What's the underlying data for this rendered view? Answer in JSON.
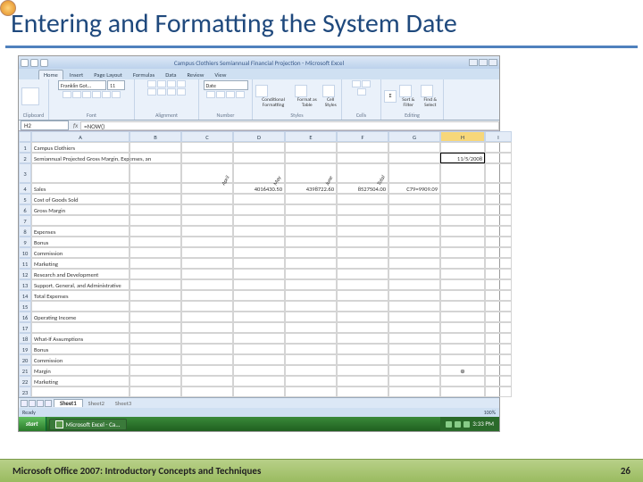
{
  "slide": {
    "title": "Entering and Formatting the System Date",
    "footer_text": "Microsoft Office 2007: Introductory Concepts and Techniques",
    "page_number": "26"
  },
  "excel": {
    "title": "Campus Clothiers Semiannual Financial Projection - Microsoft Excel",
    "tabs": [
      "Home",
      "Insert",
      "Page Layout",
      "Formulas",
      "Data",
      "Review",
      "View"
    ],
    "active_tab": "Home",
    "groups": {
      "clipboard": "Clipboard",
      "font": "Font",
      "alignment": "Alignment",
      "number": "Number",
      "styles": "Styles",
      "cells": "Cells",
      "editing": "Editing"
    },
    "font_name": "Franklin Got...",
    "font_size": "11",
    "number_format": "Date",
    "styles_btns": [
      "Conditional Formatting",
      "Format as Table",
      "Cell Styles"
    ],
    "editing_btns": [
      "Sort & Filter",
      "Find & Select"
    ],
    "namebox": "H2",
    "formula": "=NOW()",
    "col_headers": [
      "A",
      "B",
      "C",
      "D",
      "E",
      "F",
      "G",
      "H",
      "I"
    ],
    "row_numbers": [
      "1",
      "2",
      "3",
      "4",
      "5",
      "6",
      "7",
      "8",
      "9",
      "10",
      "11",
      "12",
      "13",
      "14",
      "15",
      "16",
      "17",
      "18",
      "19",
      "20",
      "21",
      "22",
      "23"
    ],
    "rows": {
      "r1_a": "Campus Clothiers",
      "r2_a": "Semiannual Projected Gross Margin, Expenses, an",
      "r2_h": "11/5/2008",
      "r3_months": [
        "April",
        "May",
        "June",
        "Total"
      ],
      "r4_a": "Sales",
      "r4_vals": [
        "4016430.50",
        "4398722.60",
        "8527504.00",
        "C79=9909.09"
      ],
      "r5_a": "Cost of Goods Sold",
      "r6_a": "Gross Margin",
      "r8_a": "Expenses",
      "r9_a": "Bonus",
      "r10_a": "Commission",
      "r11_a": "Marketing",
      "r12_a": "Research and Development",
      "r13_a": "Support, General, and Administrative",
      "r14_a": "Total Expenses",
      "r16_a": "Operating Income",
      "r18_a": "What-If Assumptions",
      "r19_a": "Bonus",
      "r20_a": "Commission",
      "r21_a": "Margin",
      "r22_a": "Marketing"
    },
    "sheet_tabs": [
      "Sheet1",
      "Sheet2",
      "Sheet3"
    ],
    "status": "Ready",
    "zoom": "100%"
  },
  "taskbar": {
    "start": "start",
    "app": "Microsoft Excel - Ca...",
    "time": "3:33 PM"
  }
}
